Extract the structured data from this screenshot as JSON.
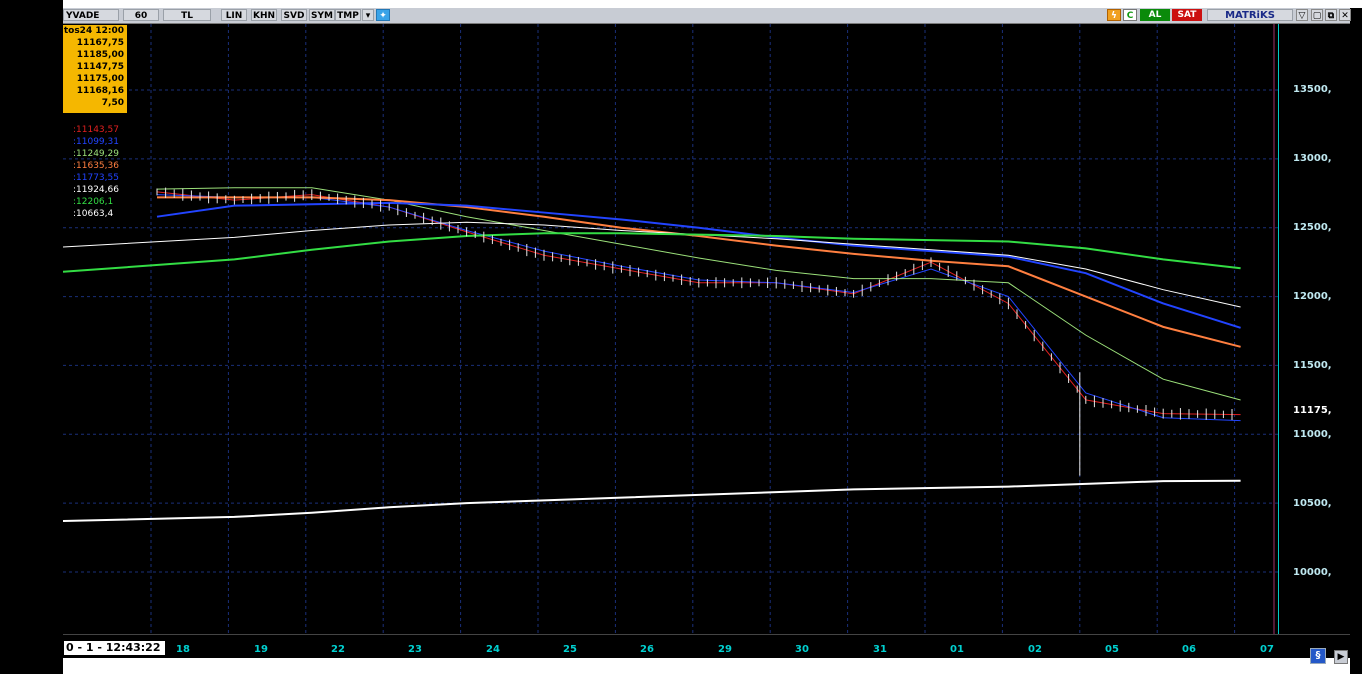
{
  "toolbar": {
    "items": [
      "YVADE",
      "60",
      "TL",
      "LIN",
      "KHN",
      "SVD",
      "SYM",
      "TMP"
    ],
    "dropdown_icon": "chevron-down-icon",
    "twitter_icon": "twitter-icon",
    "flash_icon": "lightning-icon",
    "refresh_label": "C",
    "buy_label": "AL",
    "sell_label": "SAT",
    "brand": "MATRiKS",
    "window_buttons": [
      "▽",
      "▢",
      "⧉",
      "✕"
    ]
  },
  "ohlc": {
    "lines": [
      "tos24 12:00",
      "11167,75",
      "11185,00",
      "11147,75",
      "11175,00",
      "11168,16",
      "7,50"
    ]
  },
  "legend": [
    {
      "text": ":11143,57",
      "color": "#e02020"
    },
    {
      "text": ":11099,31",
      "color": "#2244ff"
    },
    {
      "text": ":11249,29",
      "color": "#9be07a"
    },
    {
      "text": ":11635,36",
      "color": "#ff7f40"
    },
    {
      "text": ":11773,55",
      "color": "#2244ff"
    },
    {
      "text": ":11924,66",
      "color": "#ffffff"
    },
    {
      "text": ":12206,1",
      "color": "#33dd44"
    },
    {
      "text": ":10663,4",
      "color": "#ffffff"
    }
  ],
  "y_ticks": [
    "13500,",
    "13000,",
    "12500,",
    "12000,",
    "11500,",
    "11175,",
    "11000,",
    "10500,",
    "10000,"
  ],
  "x_ticks": [
    "18",
    "19",
    "22",
    "23",
    "24",
    "25",
    "26",
    "29",
    "30",
    "31",
    "01",
    "02",
    "05",
    "06",
    "07"
  ],
  "timebox": "0 - 1 - 12:43:22",
  "status_icon": "settings-swirl-icon",
  "chart_data": {
    "type": "line",
    "x": [
      "18",
      "19",
      "22",
      "23",
      "24",
      "25",
      "26",
      "29",
      "30",
      "31",
      "01",
      "02",
      "05",
      "06",
      "07"
    ],
    "ylim": [
      9600,
      13800
    ],
    "last_price": 11175,
    "series": [
      {
        "name": ":11143,57",
        "color": "#e02020",
        "values": [
          12760,
          12700,
          12740,
          12650,
          12470,
          12300,
          12200,
          12100,
          12100,
          12020,
          12250,
          11950,
          11250,
          11150,
          11143
        ]
      },
      {
        "name": ":11099,31",
        "color": "#2244ff",
        "values": [
          12740,
          12720,
          12720,
          12650,
          12480,
          12330,
          12220,
          12120,
          12100,
          12030,
          12200,
          12000,
          11300,
          11120,
          11099
        ]
      },
      {
        "name": ":11249,29",
        "color": "#9be07a",
        "values": [
          12780,
          12790,
          12790,
          12700,
          12580,
          12480,
          12380,
          12280,
          12190,
          12130,
          12130,
          12100,
          11720,
          11400,
          11249
        ]
      },
      {
        "name": ":11635,36",
        "color": "#ff7f40",
        "values": [
          12720,
          12720,
          12720,
          12700,
          12650,
          12580,
          12500,
          12440,
          12370,
          12310,
          12260,
          12220,
          12000,
          11780,
          11635
        ]
      },
      {
        "name": ":11773,55",
        "color": "#2244ff",
        "values": [
          12580,
          12660,
          12670,
          12680,
          12660,
          12610,
          12560,
          12500,
          12430,
          12370,
          12330,
          12290,
          12170,
          11950,
          11773
        ]
      },
      {
        "name": ":11924,66",
        "color": "#ffffff",
        "values": [
          12360,
          12430,
          12480,
          12520,
          12540,
          12520,
          12480,
          12450,
          12420,
          12380,
          12340,
          12300,
          12200,
          12050,
          11924
        ]
      },
      {
        "name": ":12206,1",
        "color": "#33dd44",
        "values": [
          12180,
          12270,
          12340,
          12400,
          12440,
          12460,
          12460,
          12450,
          12440,
          12420,
          12410,
          12400,
          12350,
          12270,
          12206
        ]
      },
      {
        "name": ":10663,4",
        "color": "#ffffff",
        "values": [
          10370,
          10400,
          10430,
          10470,
          10500,
          10520,
          10540,
          10560,
          10580,
          10600,
          10610,
          10620,
          10640,
          10660,
          10663
        ]
      }
    ]
  }
}
